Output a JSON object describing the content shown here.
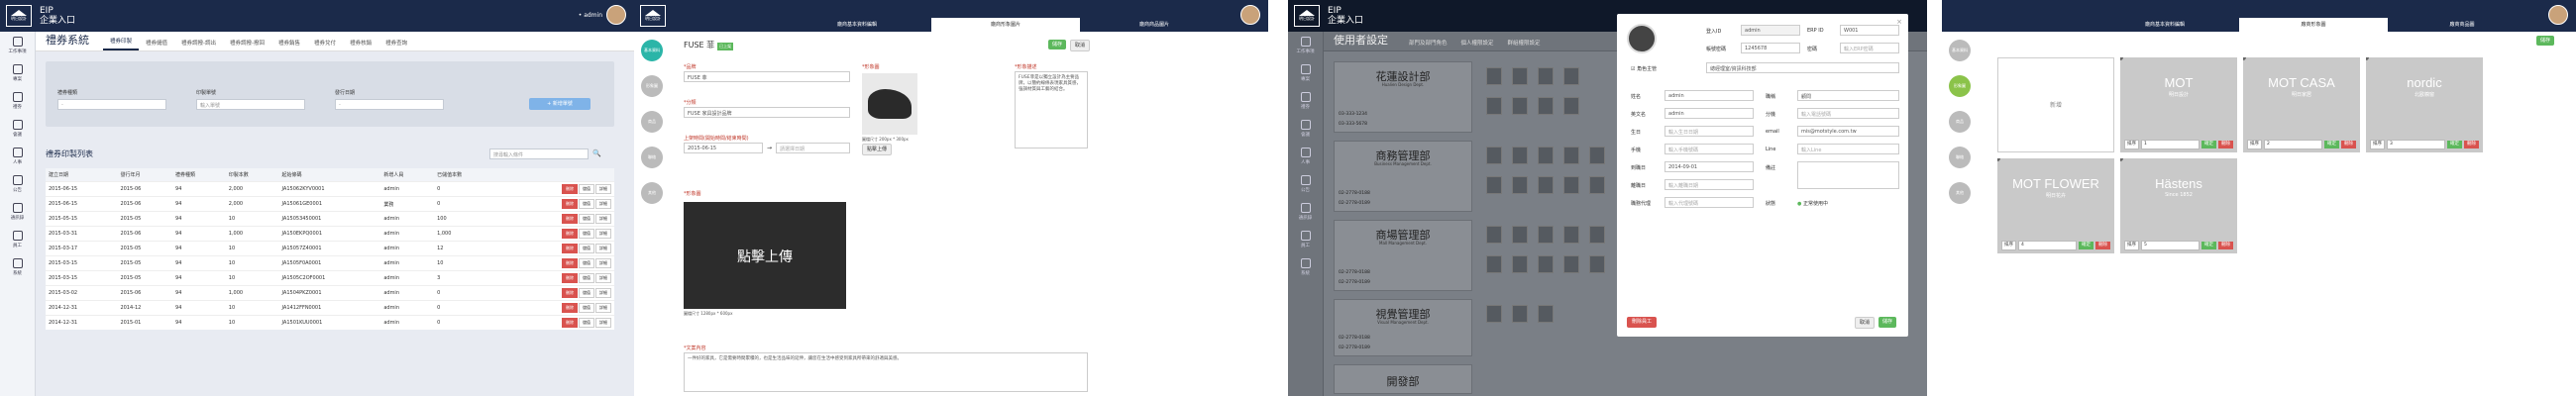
{
  "app": {
    "title_line1": "EIP",
    "title_line2": "企業入口",
    "logo_text": "明日設計",
    "user": "• admin"
  },
  "nav": [
    {
      "label": "工作事項"
    },
    {
      "label": "專案"
    },
    {
      "label": "禮券"
    },
    {
      "label": "會議"
    },
    {
      "label": "人事"
    },
    {
      "label": "公告"
    },
    {
      "label": "通訊錄"
    },
    {
      "label": "員工"
    },
    {
      "label": "系統"
    }
  ],
  "voucher": {
    "module_title": "禮券系統",
    "tabs": [
      "禮券印製",
      "禮券儲值",
      "禮券調撥-調出",
      "禮券調撥-撥回",
      "禮券銷售",
      "禮券兌付",
      "禮券核銷",
      "禮券查詢"
    ],
    "filter": {
      "type_label": "禮券種類",
      "type_value": "-",
      "number_label": "印製單號",
      "number_placeholder": "輸入單號",
      "date_label": "發行日期",
      "date_value": "-",
      "add_button": "+ 新增單號"
    },
    "list_title": "禮券印製列表",
    "search_placeholder": "搜尋輸入條件",
    "columns": [
      "建立日期",
      "發行年月",
      "禮券種類",
      "印製本數",
      "起始條碼",
      "新增人員",
      "已儲值本數",
      ""
    ],
    "rows": [
      [
        "2015-06-15",
        "2015-06",
        "94",
        "2,000",
        "JA15062KYV0001",
        "admin",
        "0"
      ],
      [
        "2015-06-15",
        "2015-06",
        "94",
        "2,000",
        "JA15061GE0001",
        "業務",
        "0"
      ],
      [
        "2015-05-15",
        "2015-05",
        "94",
        "10",
        "JA15053450001",
        "admin",
        "100"
      ],
      [
        "2015-03-31",
        "2015-06",
        "94",
        "1,000",
        "JA150EKPQ0001",
        "admin",
        "1,000"
      ],
      [
        "2015-03-17",
        "2015-05",
        "94",
        "10",
        "JA15057Z40001",
        "admin",
        "12"
      ],
      [
        "2015-03-15",
        "2015-05",
        "94",
        "10",
        "JA1505F0A0001",
        "admin",
        "10"
      ],
      [
        "2015-03-15",
        "2015-05",
        "94",
        "10",
        "JA1505C2OF0001",
        "admin",
        "3"
      ],
      [
        "2015-03-02",
        "2015-06",
        "94",
        "1,000",
        "JA1504PKZ0001",
        "admin",
        "0"
      ],
      [
        "2014-12-31",
        "2014-12",
        "94",
        "10",
        "JA1412FFN0001",
        "admin",
        "0"
      ],
      [
        "2014-12-31",
        "2015-01",
        "94",
        "10",
        "JA1501KUU0001",
        "admin",
        "0"
      ]
    ],
    "row_actions": [
      "刪除",
      "儲值",
      "詳細"
    ]
  },
  "fuse": {
    "subtabs": [
      "廠商基本資料編輯",
      "廠商形象圖片",
      "廠商商品圖片"
    ],
    "circles": [
      "基本資料",
      "形象圖",
      "商品",
      "聯絡",
      "其他"
    ],
    "heading": "FUSE 菲",
    "badge": "已上架",
    "save": "儲存",
    "cancel": "取消",
    "brand_label": "*品牌",
    "brand_value": "FUSE 菲",
    "category_label": "*分類",
    "category_value": "FUSE 家具設計品牌",
    "date_label": "上架時間(開始時間/結束時間)",
    "date_start": "2015-06-15",
    "date_end": "請選擇日期",
    "logo_label": "*形象圖",
    "logo_size": "圖檔尺寸 200px * 300px",
    "upload_text": "點擊上傳",
    "upload_size": "圖檔尺寸 1280px * 600px",
    "desc_label": "*形象描述",
    "desc_text": "FUSE菲是以獨立設計為主要品牌，以簡約線條表現家具質感，強調材質與工藝的結合。",
    "content_label": "*文案內容",
    "content_text": "一件好的家具，它是需要時間累積的，也是生活品味的延伸，讓您在生活中感受到家具所帶來的舒適與美感。"
  },
  "users": {
    "module_title": "使用者設定",
    "tabs": [
      "部門及部門角色",
      "個人權限設定",
      "群組權限設定"
    ],
    "depts": [
      {
        "name": "花蓮設計部",
        "sub": "Hualien Design Dept.",
        "phone1": "03-333-1234",
        "phone2": "03-333-5678"
      },
      {
        "name": "商務管理部",
        "sub": "Business Management Dept.",
        "phone1": "02-2778-0188",
        "phone2": "02-2778-0189"
      },
      {
        "name": "商場管理部",
        "sub": "Mall Management Dept.",
        "phone1": "02-2778-0188",
        "phone2": "02-2778-0189"
      },
      {
        "name": "視覺管理部",
        "sub": "Visual Management Dept.",
        "phone1": "02-2778-0188",
        "phone2": "02-2778-0189"
      },
      {
        "name": "開發部",
        "sub": "Development Dept.",
        "phone1": "",
        "phone2": ""
      }
    ],
    "modal": {
      "login_label": "登入ID",
      "login_value": "admin",
      "erp_label": "ERP ID",
      "erp_value": "W001",
      "acct_label": "帳號密碼",
      "acct_value": "1245678",
      "pwd_label": "密碼",
      "pwd_placeholder": "輸入ERP密碼",
      "role_label": "角色主管",
      "dept_value": "總經理室/資訊科技部",
      "name_label": "姓名",
      "name_value": "admin",
      "title_label": "職稱",
      "title_value": "顧問",
      "en_label": "英文名",
      "en_value": "admin",
      "ext_label": "分機",
      "ext_placeholder": "輸入電話號碼",
      "birth_label": "生日",
      "birth_placeholder": "輸入生日日期",
      "email_label": "email",
      "email_value": "mis@motstyle.com.tw",
      "mobile_label": "手機",
      "mobile_placeholder": "輸入手機號碼",
      "line_label": "Line",
      "line_placeholder": "輸入Line",
      "arrive_label": "到職日",
      "arrive_value": "2014-09-01",
      "note_label": "備註",
      "leave_label": "離職日",
      "leave_placeholder": "輸入離職日期",
      "agent_label": "職務代理",
      "agent_placeholder": "輸入代理號碼",
      "status_label": "狀態",
      "status_value": "正常使用中",
      "delete": "刪除員工",
      "cancel": "取消",
      "save": "儲存"
    }
  },
  "brands": {
    "subtabs": [
      "廠商基本資料編輯",
      "廠商形象圖",
      "廠商商品圖"
    ],
    "circles": [
      "基本資料",
      "形象圖",
      "商品",
      "聯絡",
      "其他"
    ],
    "save": "儲存",
    "add": "新增",
    "items": [
      {
        "name": "MOT",
        "small": "明日設計"
      },
      {
        "name": "MOT CASA",
        "small": "明日家居"
      },
      {
        "name": "nordic",
        "small": "北歐櫥窗"
      },
      {
        "name": "MOT FLOWER",
        "small": "明日花卉"
      },
      {
        "name": "Hästens",
        "small": "Since 1852"
      }
    ],
    "order_label": "排序",
    "confirm": "確定",
    "delete": "刪除"
  }
}
